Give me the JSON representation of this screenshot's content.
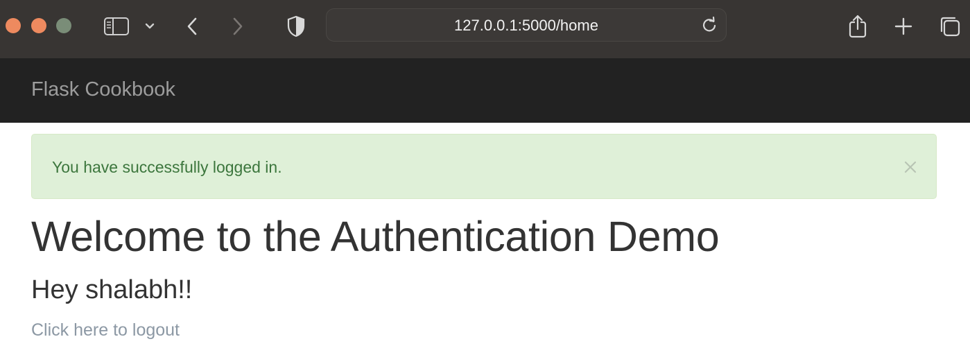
{
  "browser": {
    "url": "127.0.0.1:5000/home"
  },
  "navbar": {
    "brand": "Flask Cookbook"
  },
  "alert": {
    "message": "You have successfully logged in.",
    "close_icon": "close-icon"
  },
  "main": {
    "title": "Welcome to the Authentication Demo",
    "greeting": "Hey shalabh!!",
    "logout_link": "Click here to logout"
  },
  "colors": {
    "toolbar_bg": "#383533",
    "navbar_bg": "#222222",
    "alert_bg": "#dff0d8",
    "alert_text": "#3c763d",
    "link": "#8c98a4"
  }
}
